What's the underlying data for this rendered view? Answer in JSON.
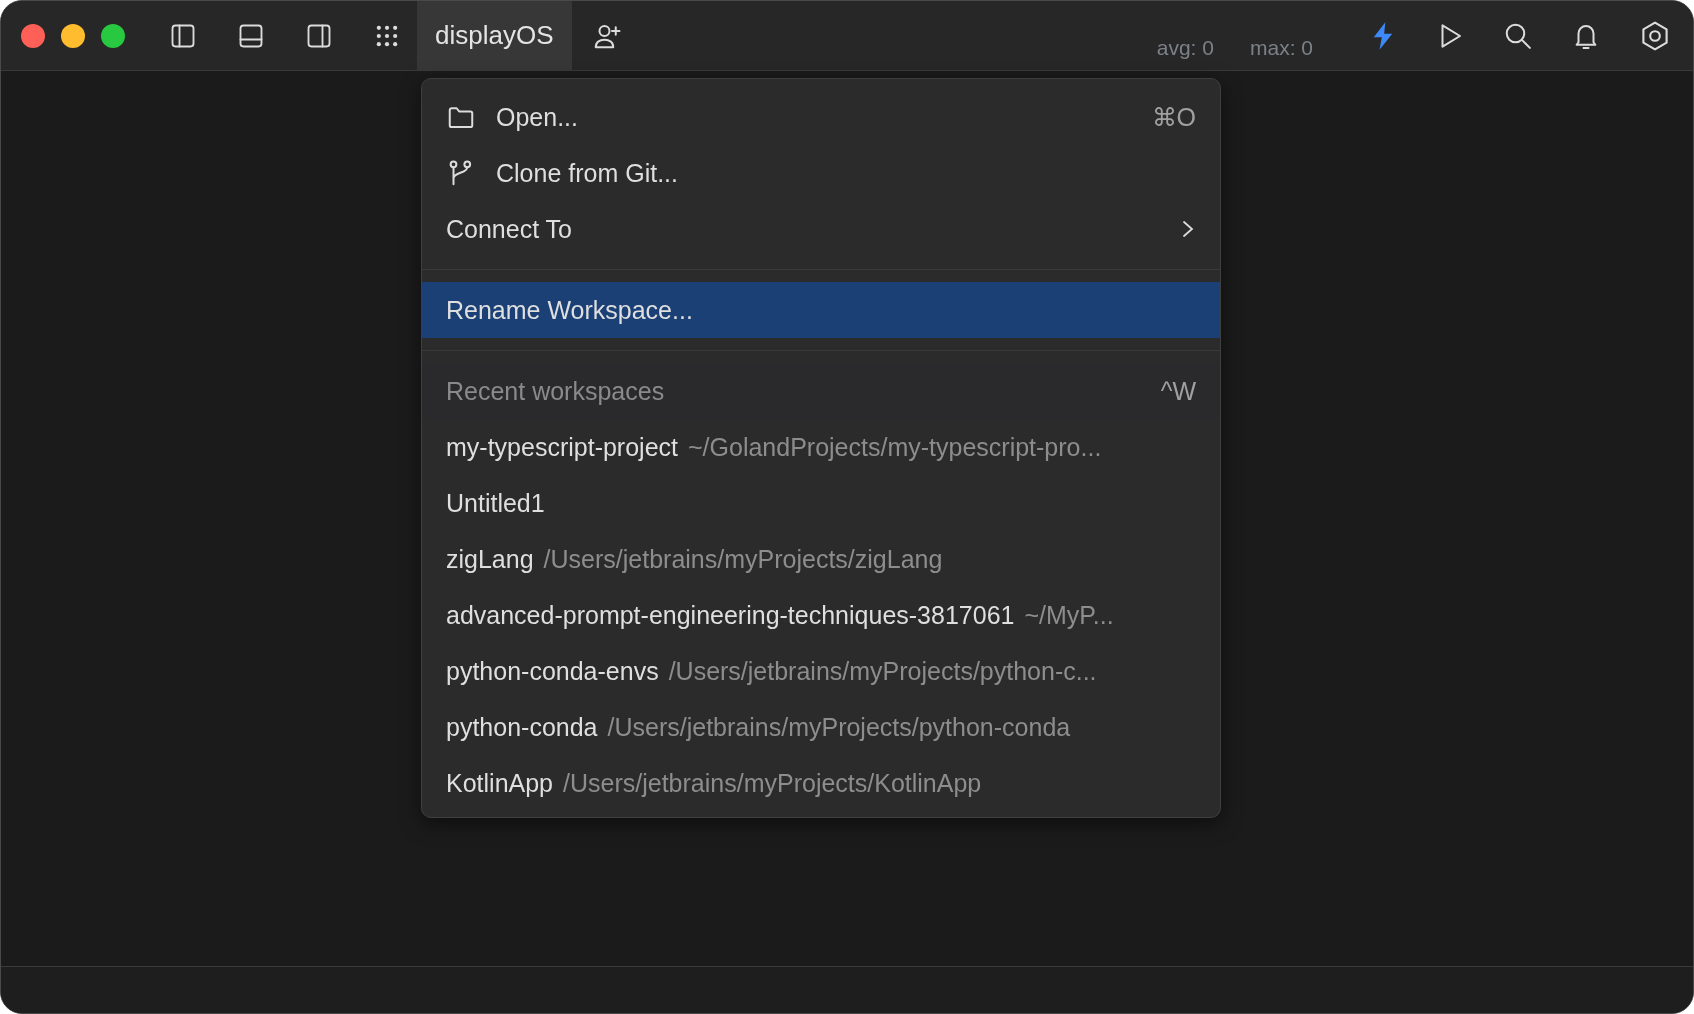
{
  "toolbar": {
    "project": {
      "label": "displayOS",
      "selected": true
    },
    "stats": [
      "avg: 0",
      "max: 0"
    ]
  },
  "menu": {
    "actions": [
      {
        "kind": "open",
        "label": "Open...",
        "shortcut": "⌘O",
        "selected": false
      },
      {
        "kind": "clone",
        "label": "Clone from Git...",
        "selected": false
      },
      {
        "kind": "submenu",
        "label": "Connect To",
        "selected": false
      }
    ],
    "rename": {
      "label": "Rename Workspace...",
      "selected": true
    },
    "recent": {
      "header": "Recent workspaces",
      "shortcut": "^W",
      "items": [
        {
          "name": "my-typescript-project",
          "path": "~/GolandProjects/my-typescript-pro...",
          "selected": false
        },
        {
          "name": "Untitled1",
          "selected": false
        },
        {
          "name": "zigLang",
          "path": "/Users/jetbrains/myProjects/zigLang",
          "selected": false
        },
        {
          "name": "advanced-prompt-engineering-techniques-3817061",
          "path": "~/MyP...",
          "selected": false
        },
        {
          "name": "python-conda-envs",
          "path": "/Users/jetbrains/myProjects/python-c...",
          "selected": false
        },
        {
          "name": "python-conda",
          "path": "/Users/jetbrains/myProjects/python-conda",
          "selected": false
        },
        {
          "name": "KotlinApp",
          "path": "/Users/jetbrains/myProjects/KotlinApp",
          "selected": false
        }
      ]
    }
  }
}
